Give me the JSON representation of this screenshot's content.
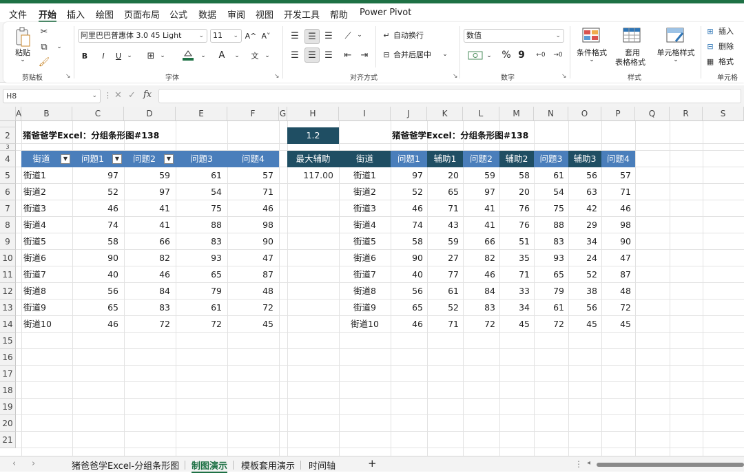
{
  "menu": {
    "items": [
      "文件",
      "开始",
      "插入",
      "绘图",
      "页面布局",
      "公式",
      "数据",
      "审阅",
      "视图",
      "开发工具",
      "帮助",
      "Power Pivot"
    ],
    "active_index": 1
  },
  "ribbon": {
    "clipboard": {
      "paste_label": "粘贴",
      "group_label": "剪贴板"
    },
    "font": {
      "font_name": "阿里巴巴普惠体 3.0 45 Light",
      "font_size": "11",
      "bold": "B",
      "italic": "I",
      "underline": "U",
      "grow": "A^",
      "shrink": "A˅",
      "font_color": "A",
      "group_label": "字体"
    },
    "alignment": {
      "wrap_text": "自动换行",
      "merge_center": "合并后居中",
      "group_label": "对齐方式"
    },
    "number": {
      "format": "数值",
      "percent": "%",
      "comma": "9",
      "group_label": "数字"
    },
    "styles": {
      "conditional": "条件格式",
      "table_format_line1": "套用",
      "table_format_line2": "表格格式",
      "cell_styles": "单元格样式",
      "group_label": "样式"
    },
    "cells": {
      "insert": "插入",
      "delete": "删除",
      "format": "格式",
      "group_label": "单元格"
    }
  },
  "formula_bar": {
    "name_box": "H8",
    "fx": "fx",
    "content": ""
  },
  "columns": [
    "A",
    "B",
    "C",
    "D",
    "E",
    "F",
    "G",
    "H",
    "I",
    "J",
    "K",
    "L",
    "M",
    "N",
    "O",
    "P",
    "Q",
    "R",
    "S"
  ],
  "rows": [
    "2",
    "3",
    "4",
    "5",
    "6",
    "7",
    "8",
    "9",
    "10",
    "11",
    "12",
    "13",
    "14",
    "15",
    "16",
    "17",
    "18",
    "19",
    "20",
    "21"
  ],
  "sheet": {
    "left_title": "猪爸爸学Excel：分组条形图#138",
    "right_title": "猪爸爸学Excel：分组条形图#138",
    "h2_value": "1.2",
    "h4_label": "最大辅助",
    "h5_value": "117.00",
    "left_headers": [
      "街道",
      "问题1",
      "问题2",
      "问题3",
      "问题4"
    ],
    "right_headers": [
      "街道",
      "问题1",
      "辅助1",
      "问题2",
      "辅助2",
      "问题3",
      "辅助3",
      "问题4"
    ],
    "streets": [
      "街道1",
      "街道2",
      "街道3",
      "街道4",
      "街道5",
      "街道6",
      "街道7",
      "街道8",
      "街道9",
      "街道10"
    ],
    "left_values": [
      [
        97,
        59,
        61,
        57
      ],
      [
        52,
        97,
        54,
        71
      ],
      [
        46,
        41,
        75,
        46
      ],
      [
        74,
        41,
        88,
        98
      ],
      [
        58,
        66,
        83,
        90
      ],
      [
        90,
        82,
        93,
        47
      ],
      [
        40,
        46,
        65,
        87
      ],
      [
        56,
        84,
        79,
        48
      ],
      [
        65,
        83,
        61,
        72
      ],
      [
        46,
        72,
        72,
        45
      ]
    ],
    "right_values": [
      [
        97,
        20,
        59,
        58,
        61,
        56,
        57
      ],
      [
        52,
        65,
        97,
        20,
        54,
        63,
        71
      ],
      [
        46,
        71,
        41,
        76,
        75,
        42,
        46
      ],
      [
        74,
        43,
        41,
        76,
        88,
        29,
        98
      ],
      [
        58,
        59,
        66,
        51,
        83,
        34,
        90
      ],
      [
        90,
        27,
        82,
        35,
        93,
        24,
        47
      ],
      [
        40,
        77,
        46,
        71,
        65,
        52,
        87
      ],
      [
        56,
        61,
        84,
        33,
        79,
        38,
        48
      ],
      [
        65,
        52,
        83,
        34,
        61,
        56,
        72
      ],
      [
        46,
        71,
        72,
        45,
        72,
        45,
        45
      ]
    ]
  },
  "tabs": {
    "items": [
      "猪爸爸学Excel-分组条形图",
      "制图演示",
      "模板套用演示",
      "时间轴"
    ],
    "active_index": 1,
    "add": "+",
    "prev": "‹",
    "next": "›"
  }
}
